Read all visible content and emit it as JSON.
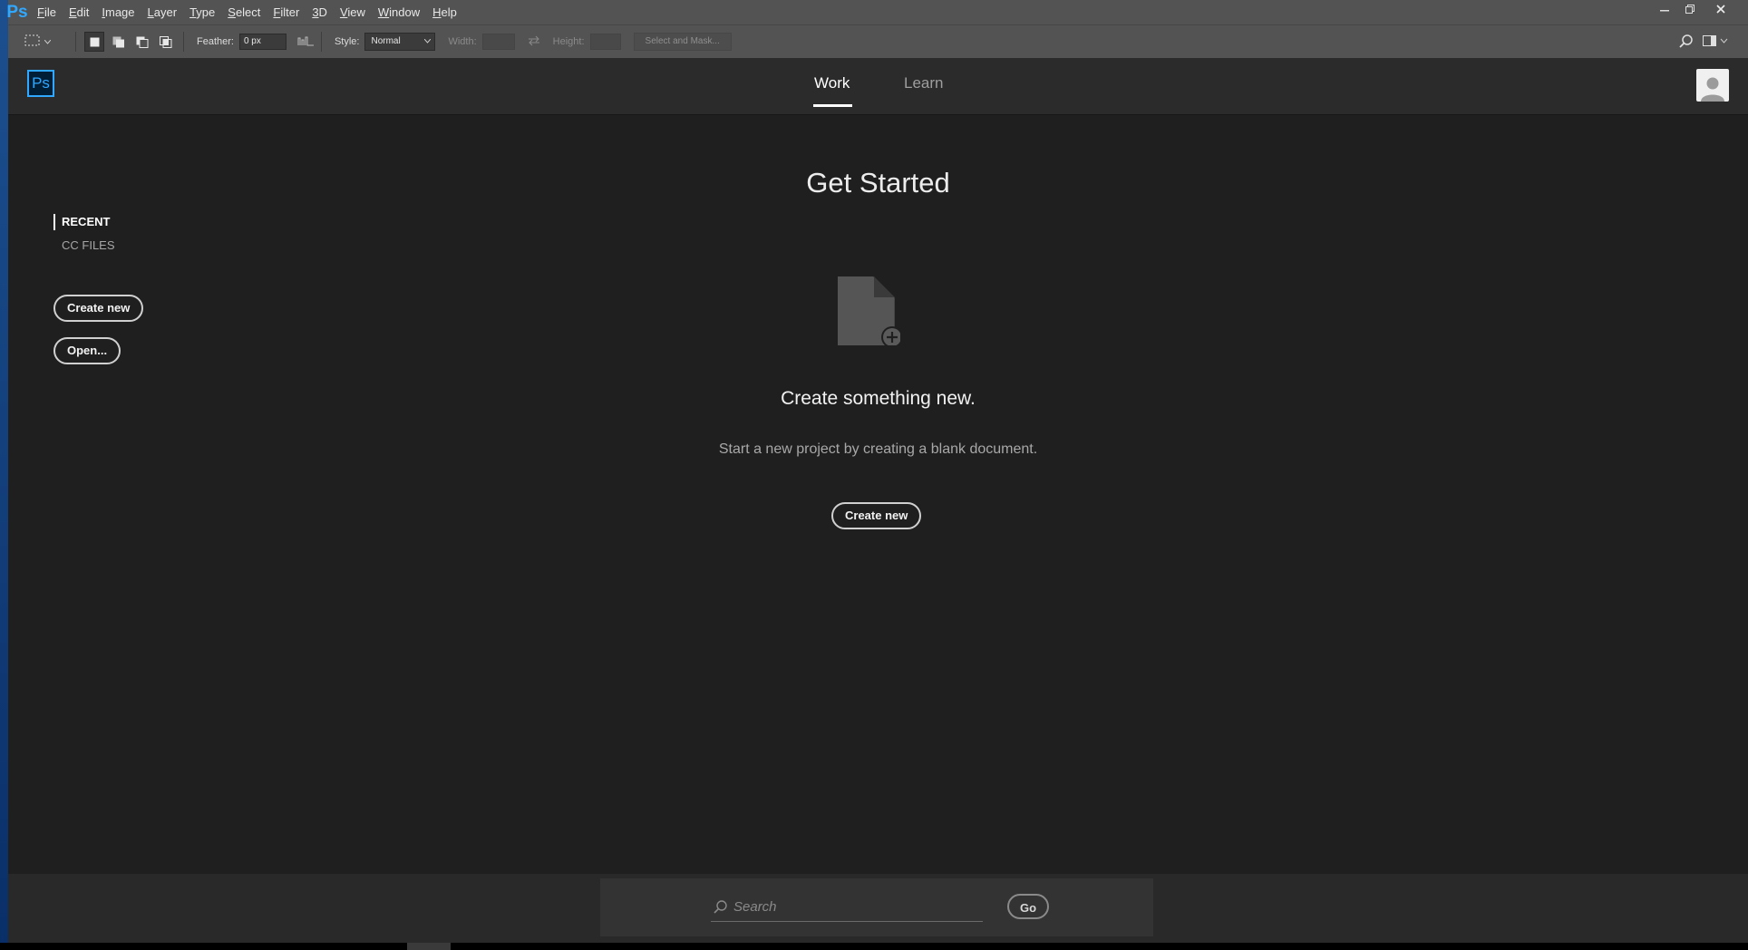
{
  "app": {
    "name": "Ps"
  },
  "menu": [
    "File",
    "Edit",
    "Image",
    "Layer",
    "Type",
    "Select",
    "Filter",
    "3D",
    "View",
    "Window",
    "Help"
  ],
  "options": {
    "feather_label": "Feather:",
    "feather_value": "0 px",
    "style_label": "Style:",
    "style_value": "Normal",
    "width_label": "Width:",
    "height_label": "Height:",
    "mask_label": "Select and Mask..."
  },
  "header": {
    "logo": "Ps",
    "tabs": [
      {
        "label": "Work"
      },
      {
        "label": "Learn"
      }
    ]
  },
  "sidebar": {
    "recent": "RECENT",
    "cc_files": "CC FILES",
    "create_new": "Create new",
    "open": "Open..."
  },
  "main": {
    "title": "Get Started",
    "headline": "Create something new.",
    "subline": "Start a new project by creating a blank document.",
    "create_new": "Create new"
  },
  "footer": {
    "search_placeholder": "Search",
    "go": "Go"
  },
  "colors": {
    "accent": "#31a8ff",
    "background": "#1f1f1f",
    "chrome": "#535353"
  },
  "icons": [
    "marquee-tool-icon",
    "new-selection-icon",
    "add-selection-icon",
    "subtract-selection-icon",
    "intersect-selection-icon",
    "anti-alias-icon",
    "swap-icon",
    "search-icon",
    "workspace-icon",
    "document-add-icon",
    "avatar-icon"
  ]
}
